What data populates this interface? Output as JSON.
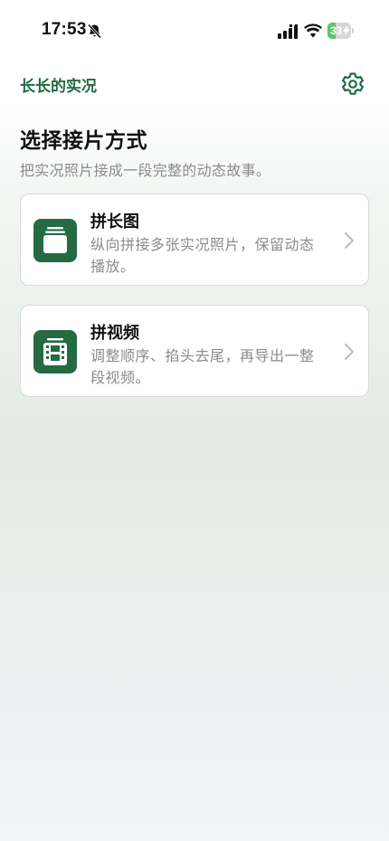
{
  "status_bar": {
    "time": "17:53",
    "battery_level": "33",
    "battery_fraction": 0.33,
    "icons": [
      "bell-slash-icon",
      "cellular-signal-icon",
      "wifi-icon",
      "battery-icon",
      "charging-bolt-icon"
    ]
  },
  "nav": {
    "title": "长长的实况",
    "settings_icon": "gear-icon"
  },
  "header": {
    "title": "选择接片方式",
    "subtitle": "把实况照片接成一段完整的动态故事。"
  },
  "options": [
    {
      "title": "拼长图",
      "description": "纵向拼接多张实况照片，保留动态播放。",
      "icon": "stacked-photos-icon"
    },
    {
      "title": "拼视频",
      "description": "调整顺序、掐头去尾，再导出一整段视频。",
      "icon": "film-strip-icon"
    }
  ],
  "colors": {
    "accent": "#1f6b43",
    "icon_tile": "#246b44",
    "secondary_text": "#8b8b8b",
    "card_border": "#d9d9d9",
    "battery_fill": "#5fc46a"
  }
}
